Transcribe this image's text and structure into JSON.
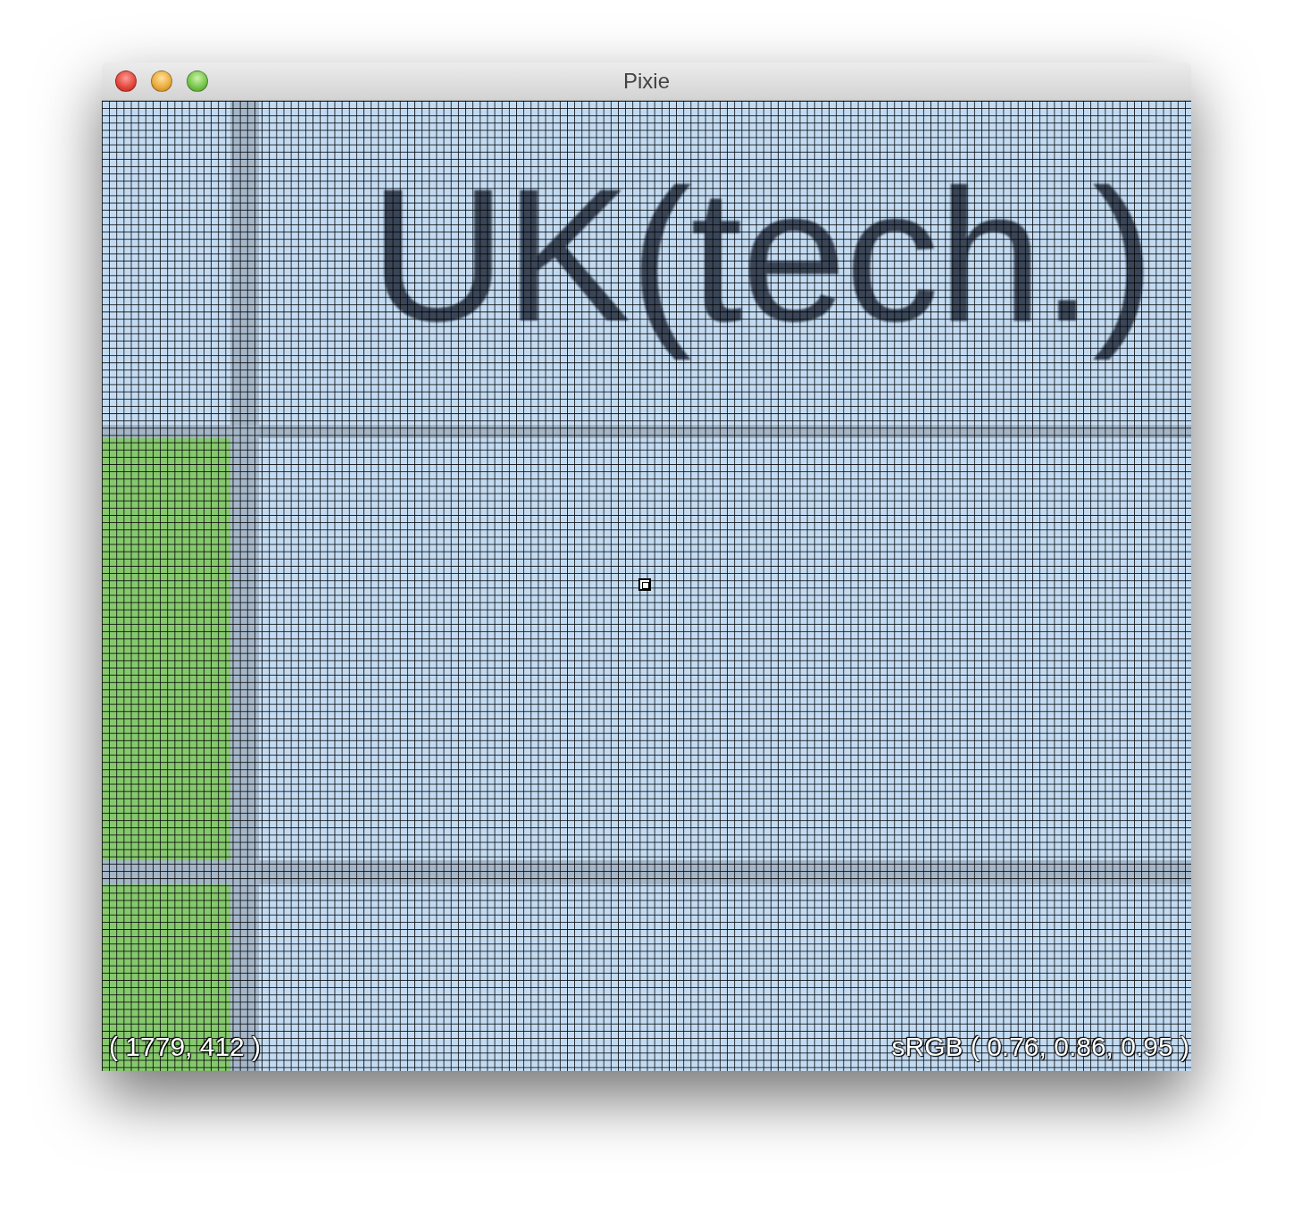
{
  "window": {
    "title": "Pixie"
  },
  "magnified_view": {
    "text": "UK(tech.)"
  },
  "status": {
    "coordinates": "( 1779, 412 )",
    "color_reading": "sRGB ( 0.76, 0.86, 0.95 )"
  }
}
